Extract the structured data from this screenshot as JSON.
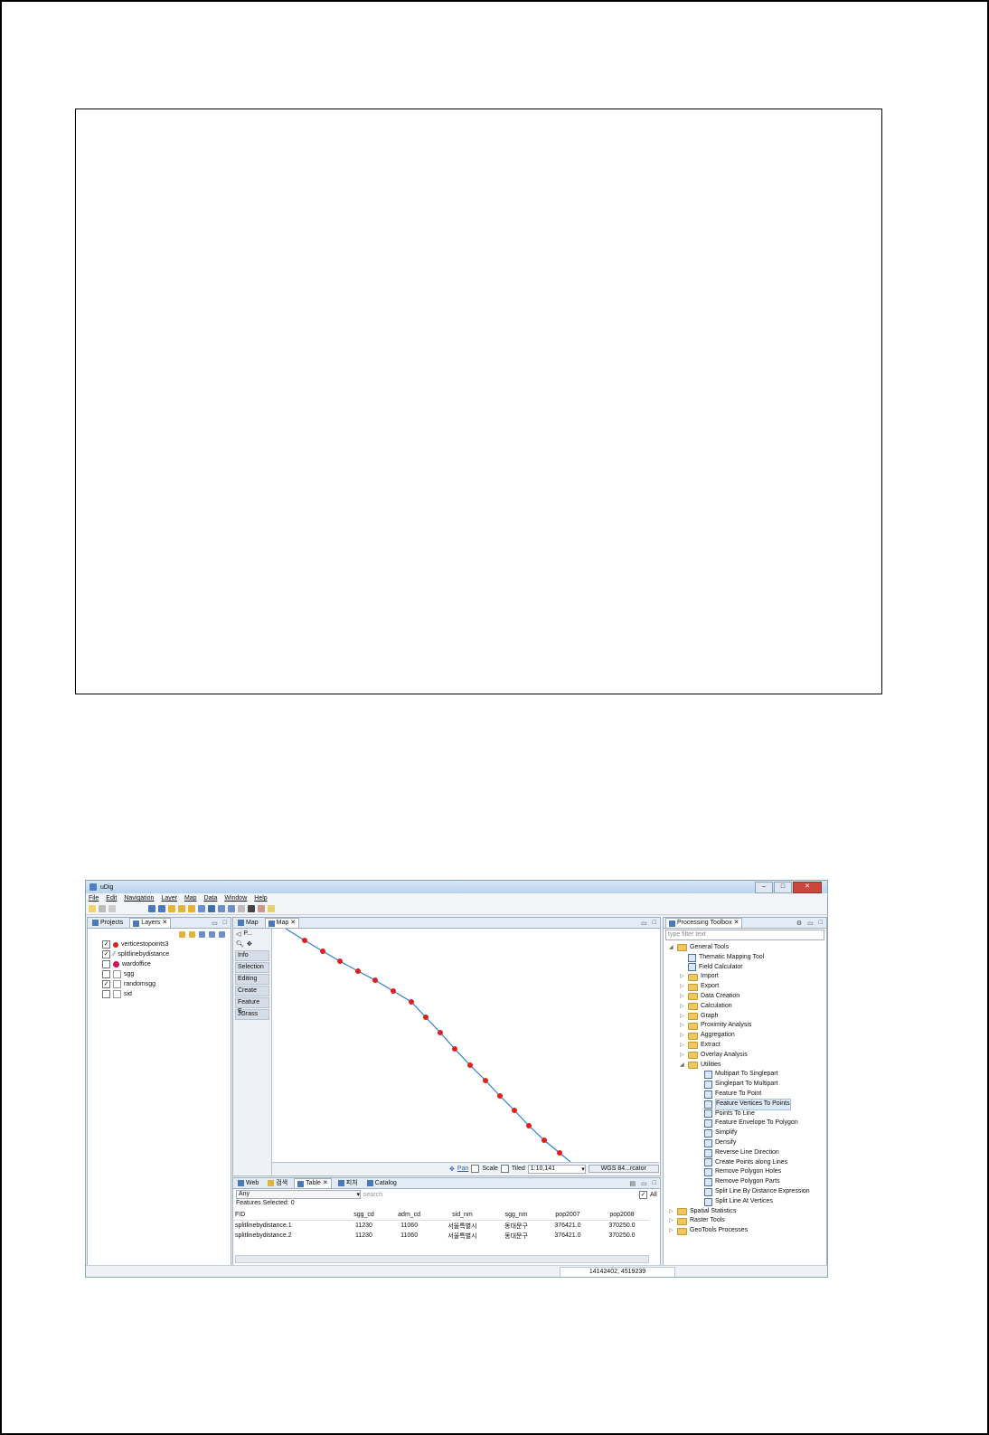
{
  "window": {
    "title": "uDig",
    "controls": [
      "–",
      "□",
      "✕"
    ]
  },
  "menu": [
    "File",
    "Edit",
    "Navigation",
    "Layer",
    "Map",
    "Data",
    "Window",
    "Help"
  ],
  "layers_panel": {
    "tabs": [
      "Projects",
      "Layers"
    ],
    "layers": [
      {
        "name": "verticestopoints3",
        "checked": "✓",
        "symbol": "point-red"
      },
      {
        "name": "splitlinebydistance",
        "checked": "✓",
        "symbol": "line"
      },
      {
        "name": "wardoffice",
        "checked": "",
        "symbol": "point-red-large"
      },
      {
        "name": "sgg",
        "checked": "",
        "symbol": "polygon"
      },
      {
        "name": "randomsgg",
        "checked": "✓",
        "symbol": "polygon"
      },
      {
        "name": "sid",
        "checked": "",
        "symbol": "polygon"
      }
    ]
  },
  "map_panel": {
    "tabs": [
      "Map",
      "Map"
    ],
    "side_tab": "P...",
    "side_buttons": [
      "Info",
      "Selection",
      "Editing",
      "Create",
      "Feature E...",
      "JGrass"
    ],
    "status": {
      "pan_label": "Pan",
      "scale_label": "Scale",
      "tiled_label": "Tiled",
      "scale_value": "1:10,141",
      "crs": "WGS 84...rcator"
    }
  },
  "bottom_panel": {
    "tabs": [
      "Web",
      "검색",
      "Table",
      "피처",
      "Catalog"
    ],
    "filter_value": "Any",
    "search_placeholder": "search",
    "all_label": "All",
    "features_selected": "Features Selected: 0",
    "columns": [
      "FID",
      "sgg_cd",
      "adm_cd",
      "sid_nm",
      "sgg_nm",
      "pop2007",
      "pop2008"
    ],
    "rows": [
      [
        "splitlinebydistance.1",
        "11230",
        "11060",
        "서울특별시",
        "동대문구",
        "376421.0",
        "370250.0"
      ],
      [
        "splitlinebydistance.2",
        "11230",
        "11060",
        "서울특별시",
        "동대문구",
        "376421.0",
        "370250.0"
      ]
    ]
  },
  "toolbox": {
    "tab": "Processing Toolbox",
    "filter_placeholder": "type filter text",
    "tree": [
      {
        "label": "General Tools",
        "kind": "folder",
        "level": 0,
        "arrow": "◢"
      },
      {
        "label": "Thematic Mapping Tool",
        "kind": "tool",
        "level": 1,
        "arrow": ""
      },
      {
        "label": "Field Calculator",
        "kind": "tool",
        "level": 1,
        "arrow": ""
      },
      {
        "label": "Import",
        "kind": "folder",
        "level": 1,
        "arrow": "▷"
      },
      {
        "label": "Export",
        "kind": "folder",
        "level": 1,
        "arrow": "▷"
      },
      {
        "label": "Data Creation",
        "kind": "folder",
        "level": 1,
        "arrow": "▷"
      },
      {
        "label": "Calculation",
        "kind": "folder",
        "level": 1,
        "arrow": "▷"
      },
      {
        "label": "Graph",
        "kind": "folder",
        "level": 1,
        "arrow": "▷"
      },
      {
        "label": "Proximity Analysis",
        "kind": "folder",
        "level": 1,
        "arrow": "▷"
      },
      {
        "label": "Aggregation",
        "kind": "folder",
        "level": 1,
        "arrow": "▷"
      },
      {
        "label": "Extract",
        "kind": "folder",
        "level": 1,
        "arrow": "▷"
      },
      {
        "label": "Overlay Analysis",
        "kind": "folder",
        "level": 1,
        "arrow": "▷"
      },
      {
        "label": "Utilities",
        "kind": "folder",
        "level": 1,
        "arrow": "◢"
      },
      {
        "label": "Multipart To Singlepart",
        "kind": "tool",
        "level": 2,
        "arrow": ""
      },
      {
        "label": "Singlepart To Multipart",
        "kind": "tool",
        "level": 2,
        "arrow": ""
      },
      {
        "label": "Feature To Point",
        "kind": "tool",
        "level": 2,
        "arrow": ""
      },
      {
        "label": "Feature Vertices To Points",
        "kind": "tool",
        "level": 2,
        "arrow": "",
        "selected": true
      },
      {
        "label": "Points To Line",
        "kind": "tool",
        "level": 2,
        "arrow": ""
      },
      {
        "label": "Feature Envelope To Polygon",
        "kind": "tool",
        "level": 2,
        "arrow": ""
      },
      {
        "label": "Simplify",
        "kind": "tool",
        "level": 2,
        "arrow": ""
      },
      {
        "label": "Densify",
        "kind": "tool",
        "level": 2,
        "arrow": ""
      },
      {
        "label": "Reverse Line Direction",
        "kind": "tool",
        "level": 2,
        "arrow": ""
      },
      {
        "label": "Create Points along Lines",
        "kind": "tool",
        "level": 2,
        "arrow": ""
      },
      {
        "label": "Remove Polygon Holes",
        "kind": "tool",
        "level": 2,
        "arrow": ""
      },
      {
        "label": "Remove Polygon Parts",
        "kind": "tool",
        "level": 2,
        "arrow": ""
      },
      {
        "label": "Split Line By Distance Expression",
        "kind": "tool",
        "level": 2,
        "arrow": ""
      },
      {
        "label": "Split Line At Vertices",
        "kind": "tool",
        "level": 2,
        "arrow": ""
      },
      {
        "label": "Spatial Statistics",
        "kind": "folder",
        "level": 0,
        "arrow": "▷"
      },
      {
        "label": "Raster Tools",
        "kind": "folder",
        "level": 0,
        "arrow": "▷"
      },
      {
        "label": "GeoTools Processes",
        "kind": "folder",
        "level": 0,
        "arrow": "▷"
      }
    ]
  },
  "statusbar": {
    "coordinates": "14142402, 4519239"
  },
  "colors": {
    "line": "#2b7fd6",
    "point": "#e02020"
  }
}
